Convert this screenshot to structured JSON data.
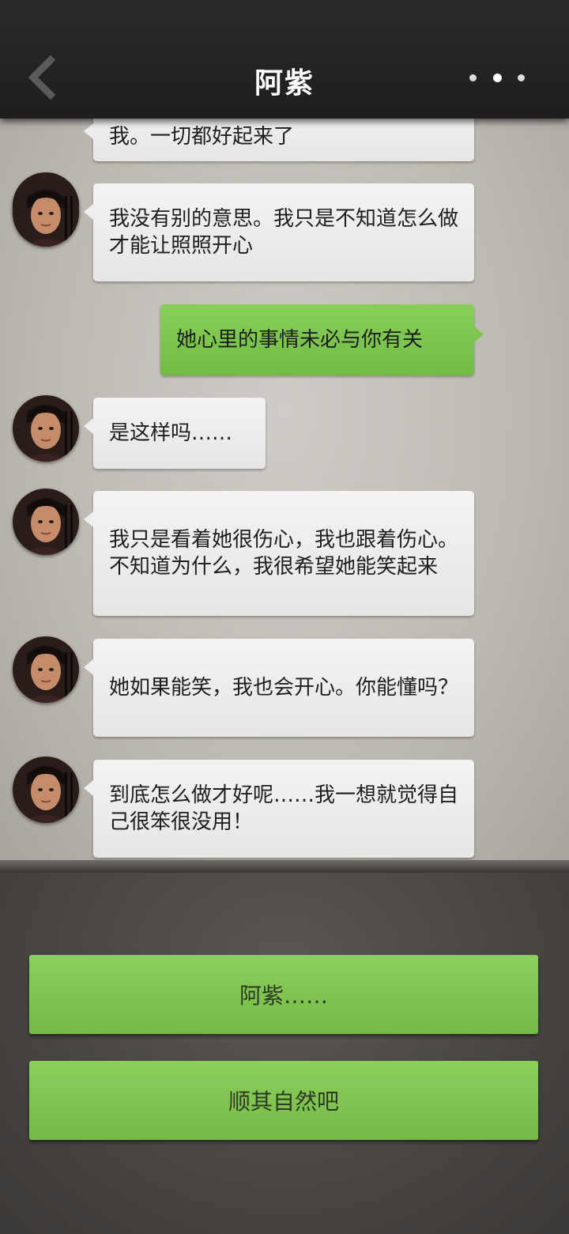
{
  "header": {
    "title": "阿紫",
    "back_icon": "chevron-left-icon",
    "more_icon": "more-dots-icon"
  },
  "messages": [
    {
      "side": "in",
      "text": "我。一切都好起来了"
    },
    {
      "side": "in",
      "text": "我没有别的意思。我只是不知道怎么做才能让照照开心"
    },
    {
      "side": "out",
      "text": "她心里的事情未必与你有关"
    },
    {
      "side": "in",
      "text": "是这样吗……"
    },
    {
      "side": "in",
      "text": "我只是看着她很伤心，我也跟着伤心。不知道为什么，我很希望她能笑起来"
    },
    {
      "side": "in",
      "text": "她如果能笑，我也会开心。你能懂吗？"
    },
    {
      "side": "in",
      "text": "到底怎么做才好呢……我一想就觉得自己很笨很没用！"
    }
  ],
  "choices": [
    {
      "label": "阿紫……"
    },
    {
      "label": "顺其自然吧"
    }
  ],
  "colors": {
    "header_bg": "#242221",
    "paper_bg": "#c9c5c0",
    "bubble_in": "#efefef",
    "bubble_out": "#7cc64f",
    "choice_button": "#80c452"
  }
}
